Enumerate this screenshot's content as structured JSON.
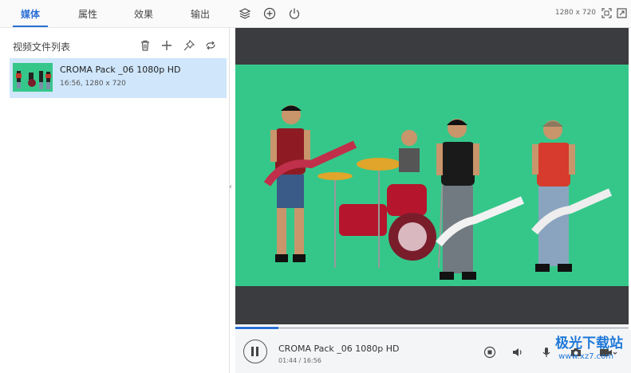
{
  "tabs": [
    {
      "label": "媒体",
      "active": true
    },
    {
      "label": "属性",
      "active": false
    },
    {
      "label": "效果",
      "active": false
    },
    {
      "label": "输出",
      "active": false
    }
  ],
  "top_icons": [
    "layers-icon",
    "add-circle-icon",
    "power-icon"
  ],
  "resolution": "1280 x 720",
  "left_panel": {
    "title": "视频文件列表",
    "icons": [
      "trash-icon",
      "plus-icon",
      "pin-icon",
      "loop-icon"
    ],
    "items": [
      {
        "title": "CROMA Pack _06 1080p HD",
        "meta": "16:56, 1280 x 720"
      }
    ]
  },
  "player": {
    "title": "CROMA Pack _06 1080p HD",
    "time": "01:44 / 16:56",
    "progress": 0.11
  },
  "control_icons": [
    "stop-icon",
    "volume-icon",
    "mic-icon",
    "camera-icon",
    "video-camera-icon"
  ],
  "watermark": {
    "main": "极光下载站",
    "sub": "www.xz7.com"
  },
  "colors": {
    "accent": "#2b6fd6",
    "chroma_green": "#35c78a",
    "preview_bg": "#3b3c3f",
    "selected_item": "#cfe6fb"
  }
}
